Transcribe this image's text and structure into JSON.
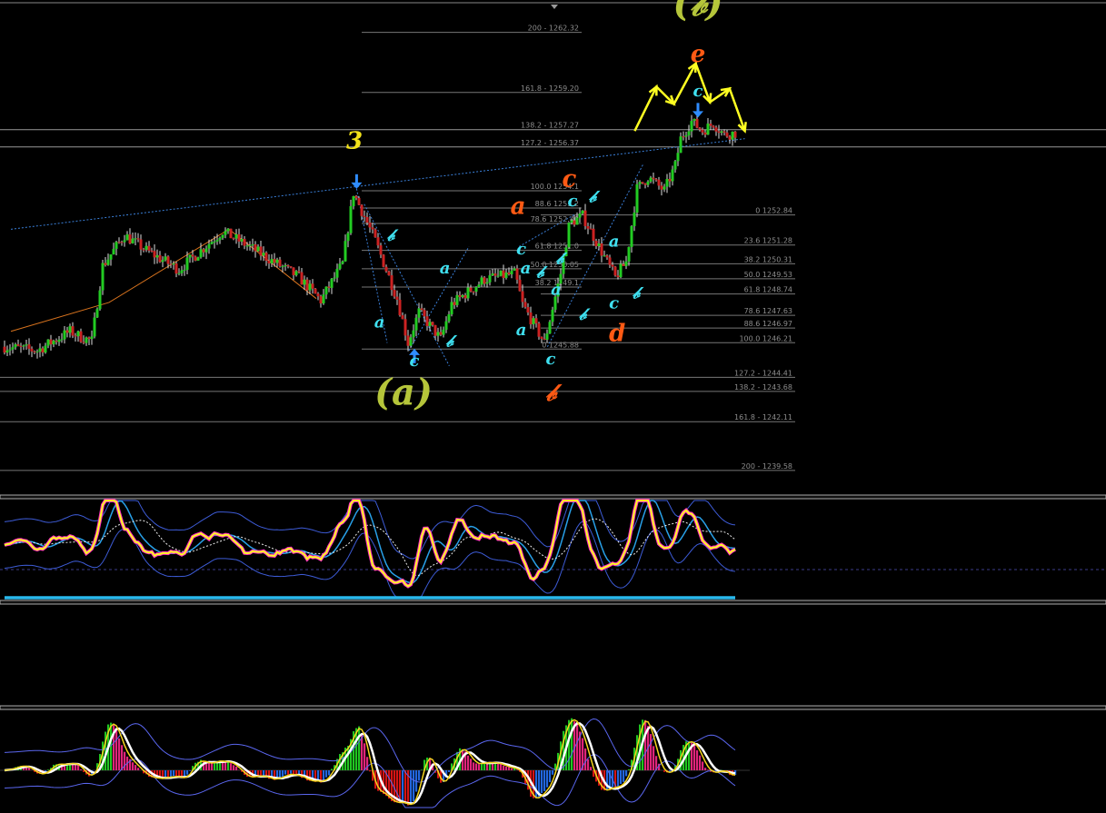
{
  "colors": {
    "background": "#000000",
    "bull_candle": "#22cc22",
    "bear_candle": "#cc2222",
    "wick": "#dddddd",
    "fib_line": "#777777",
    "trendline": "#3a7fd8",
    "major_wave_label": "#b5c53a",
    "wave3_label": "#f2e21a",
    "orange_label": "#ff5a14",
    "cyan_label": "#3fe0f0",
    "arrow_yellow": "#ffff22",
    "arrow_blue": "#2f8cff"
  },
  "chart_data": {
    "type": "candlestick",
    "main_panel": {
      "ylim": [
        1238.3,
        1264.0
      ],
      "fib_levels_upper": [
        {
          "ratio": "200",
          "price": 1262.32,
          "label": "200 - 1262.32"
        },
        {
          "ratio": "161.8",
          "price": 1259.2,
          "label": "161.8 - 1259.20"
        },
        {
          "ratio": "138.2",
          "price": 1257.27,
          "label": "138.2 - 1257.27"
        },
        {
          "ratio": "127.2",
          "price": 1256.37,
          "label": "127.2 - 1256.37"
        },
        {
          "ratio": "100.0",
          "price": 1254.1,
          "label": "100.0 1254.1"
        },
        {
          "ratio": "88.6",
          "price": 1253.2,
          "label": "88.6 1253.2"
        },
        {
          "ratio": "78.6",
          "price": 1252.4,
          "label": "78.6 1252.40"
        },
        {
          "ratio": "61.8",
          "price": 1251.0,
          "label": "61.8 1251.0"
        },
        {
          "ratio": "50.0",
          "price": 1250.05,
          "label": "50.0 1250.05"
        },
        {
          "ratio": "38.2",
          "price": 1249.1,
          "label": "38.2 1249.1"
        },
        {
          "ratio": "0",
          "price": 1245.88,
          "label": "0 1245.88"
        }
      ],
      "fib_levels_lower": [
        {
          "ratio": "0",
          "price": 1252.84,
          "label": "0 1252.84"
        },
        {
          "ratio": "23.6",
          "price": 1251.28,
          "label": "23.6 1251.28"
        },
        {
          "ratio": "38.2",
          "price": 1250.31,
          "label": "38.2 1250.31"
        },
        {
          "ratio": "50.0",
          "price": 1249.53,
          "label": "50.0 1249.53"
        },
        {
          "ratio": "61.8",
          "price": 1248.74,
          "label": "61.8 1248.74"
        },
        {
          "ratio": "78.6",
          "price": 1247.63,
          "label": "78.6 1247.63"
        },
        {
          "ratio": "88.6",
          "price": 1246.97,
          "label": "88.6 1246.97"
        },
        {
          "ratio": "100.0",
          "price": 1246.21,
          "label": "100.0 1246.21"
        },
        {
          "ratio": "127.2",
          "price": 1244.41,
          "label": "127.2 - 1244.41"
        },
        {
          "ratio": "138.2",
          "price": 1243.68,
          "label": "138.2 - 1243.68"
        },
        {
          "ratio": "161.8",
          "price": 1242.11,
          "label": "161.8 - 1242.11"
        },
        {
          "ratio": "200",
          "price": 1239.58,
          "label": "200 - 1239.58"
        }
      ],
      "wave_labels": [
        {
          "text": "(𝒷)",
          "bar": 63,
          "price": 1263.2,
          "size": 40,
          "color_key": "major_wave_label"
        },
        {
          "text": "(a)",
          "bar": 36,
          "price": 1243.0,
          "size": 40,
          "color_key": "major_wave_label"
        },
        {
          "text": "3",
          "bar": 31.5,
          "price": 1256.3,
          "size": 26,
          "color_key": "wave3_label"
        },
        {
          "text": "e",
          "bar": 63,
          "price": 1260.8,
          "size": 26,
          "color_key": "orange_label"
        },
        {
          "text": "c",
          "bar": 51.2,
          "price": 1254.3,
          "size": 26,
          "color_key": "orange_label"
        },
        {
          "text": "a",
          "bar": 46.5,
          "price": 1252.9,
          "size": 26,
          "color_key": "orange_label"
        },
        {
          "text": "d",
          "bar": 55.6,
          "price": 1246.3,
          "size": 26,
          "color_key": "orange_label"
        },
        {
          "text": "𝒷",
          "bar": 49.5,
          "price": 1243.2,
          "size": 26,
          "color_key": "orange_label"
        },
        {
          "text": "c",
          "bar": 63,
          "price": 1259.0,
          "size": 18,
          "color_key": "cyan_label"
        },
        {
          "text": "𝒷",
          "bar": 34.8,
          "price": 1251.5,
          "size": 18,
          "color_key": "cyan_label"
        },
        {
          "text": "a",
          "bar": 33.8,
          "price": 1247.0,
          "size": 18,
          "color_key": "cyan_label"
        },
        {
          "text": "c",
          "bar": 37.0,
          "price": 1245.0,
          "size": 18,
          "color_key": "cyan_label"
        },
        {
          "text": "a",
          "bar": 39.8,
          "price": 1249.8,
          "size": 18,
          "color_key": "cyan_label"
        },
        {
          "text": "𝒷",
          "bar": 40.2,
          "price": 1246.0,
          "size": 18,
          "color_key": "cyan_label"
        },
        {
          "text": "c",
          "bar": 46.8,
          "price": 1250.8,
          "size": 18,
          "color_key": "cyan_label"
        },
        {
          "text": "𝒷",
          "bar": 48.5,
          "price": 1249.6,
          "size": 18,
          "color_key": "cyan_label"
        },
        {
          "text": "a",
          "bar": 46.8,
          "price": 1246.6,
          "size": 18,
          "color_key": "cyan_label"
        },
        {
          "text": "c",
          "bar": 49.5,
          "price": 1245.1,
          "size": 18,
          "color_key": "cyan_label"
        },
        {
          "text": "a",
          "bar": 50.0,
          "price": 1248.7,
          "size": 18,
          "color_key": "cyan_label"
        },
        {
          "text": "c",
          "bar": 51.5,
          "price": 1253.3,
          "size": 18,
          "color_key": "cyan_label"
        },
        {
          "text": "𝒷",
          "bar": 53.3,
          "price": 1253.5,
          "size": 18,
          "color_key": "cyan_label"
        },
        {
          "text": "a",
          "bar": 55.3,
          "price": 1251.2,
          "size": 18,
          "color_key": "cyan_label"
        },
        {
          "text": "𝒷",
          "bar": 52.4,
          "price": 1247.4,
          "size": 18,
          "color_key": "cyan_label"
        },
        {
          "text": "c",
          "bar": 55.3,
          "price": 1248.0,
          "size": 18,
          "color_key": "cyan_label"
        },
        {
          "text": "𝒷",
          "bar": 57.3,
          "price": 1248.5,
          "size": 18,
          "color_key": "cyan_label"
        },
        {
          "text": "a",
          "bar": 47.2,
          "price": 1249.8,
          "size": 18,
          "color_key": "cyan_label"
        },
        {
          "text": "𝒷",
          "bar": 50.3,
          "price": 1250.3,
          "size": 18,
          "color_key": "cyan_label"
        }
      ],
      "wave_path": [
        {
          "bar": 57.2,
          "price": 1257.2
        },
        {
          "bar": 59.2,
          "price": 1259.5
        },
        {
          "bar": 60.8,
          "price": 1258.6
        },
        {
          "bar": 62.8,
          "price": 1260.7
        },
        {
          "bar": 64.1,
          "price": 1258.7
        },
        {
          "bar": 65.9,
          "price": 1259.4
        },
        {
          "bar": 67.3,
          "price": 1257.2
        }
      ],
      "arrows_down": [
        {
          "bar": 31.7,
          "price": 1254.2
        },
        {
          "bar": 63.0,
          "price": 1257.9
        }
      ],
      "arrows_up": [
        {
          "bar": 37.0,
          "price": 1245.9
        }
      ],
      "trendline": [
        [
          0,
          1252.1
        ],
        [
          67.3,
          1256.8
        ]
      ]
    }
  }
}
